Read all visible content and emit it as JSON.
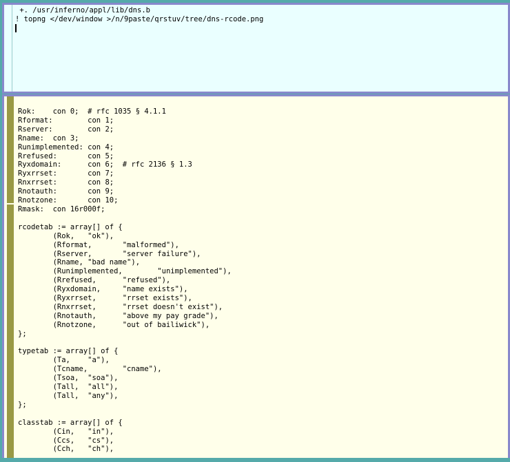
{
  "colors": {
    "desktop": "#55aaaa",
    "window_border": "#8888cc",
    "command_background": "#eaffff",
    "code_background": "#ffffea",
    "code_scrollbar": "#999944"
  },
  "command_window": {
    "lines": [
      " +. /usr/inferno/appl/lib/dns.b",
      "! topng </dev/window >/n/9paste/qrstuv/tree/dns-rcode.png"
    ]
  },
  "code_window": {
    "lines": [
      "Rok:\tcon 0;\t# rfc 1035 § 4.1.1",
      "Rformat:\tcon 1;",
      "Rserver:\tcon 2;",
      "Rname:\tcon 3;",
      "Runimplemented:\tcon 4;",
      "Rrefused:\tcon 5;",
      "Ryxdomain:\tcon 6;\t# rfc 2136 § 1.3",
      "Ryxrrset:\tcon 7;",
      "Rnxrrset:\tcon 8;",
      "Rnotauth:\tcon 9;",
      "Rnotzone:\tcon 10;",
      "Rmask:\tcon 16r000f;",
      "",
      "rcodetab := array[] of {",
      "\t(Rok,\t\"ok\"),",
      "\t(Rformat,\t\"malformed\"),",
      "\t(Rserver,\t\"server failure\"),",
      "\t(Rname,\t\"bad name\"),",
      "\t(Runimplemented,\t\"unimplemented\"),",
      "\t(Rrefused,\t\"refused\"),",
      "\t(Ryxdomain,\t\"name exists\"),",
      "\t(Ryxrrset,\t\"rrset exists\"),",
      "\t(Rnxrrset,\t\"rrset doesn't exist\"),",
      "\t(Rnotauth,\t\"above my pay grade\"),",
      "\t(Rnotzone,\t\"out of bailiwick\"),",
      "};",
      "",
      "typetab := array[] of {",
      "\t(Ta,\t\"a\"),",
      "\t(Tcname,\t\"cname\"),",
      "\t(Tsoa,\t\"soa\"),",
      "\t(Tall,\t\"all\"),",
      "\t(Tall,\t\"any\"),",
      "};",
      "",
      "classtab := array[] of {",
      "\t(Cin,\t\"in\"),",
      "\t(Ccs,\t\"cs\"),",
      "\t(Cch,\t\"ch\"),"
    ]
  }
}
